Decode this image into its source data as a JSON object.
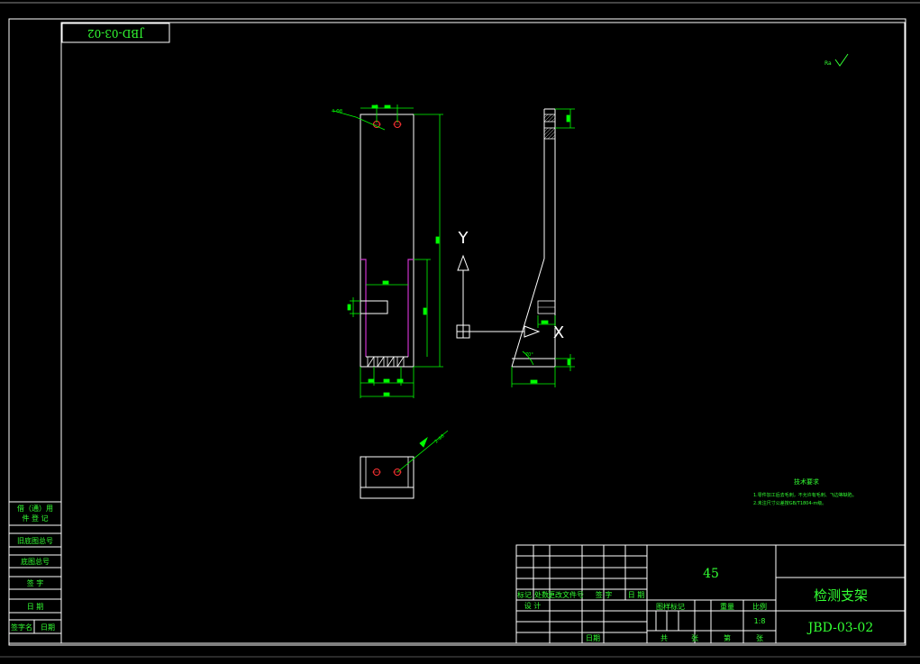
{
  "drawing": {
    "code_top": "JBD-03-02",
    "material": "45",
    "title": "检测支架",
    "code": "JBD-03-02",
    "scale": "1:8"
  },
  "annotations": {
    "axis_y": "Y",
    "axis_x": "X",
    "tech_title": "技术要求",
    "tech_line_1": "1.零件加工后去毛刺，不允许有毛刺、飞边等缺陷。",
    "tech_line_2": "2.未注尺寸公差按GB/T1804-m级。"
  },
  "left_labels": [
    "借（通）用",
    "件 登 记",
    "旧底图总号",
    "底图总号",
    "签  字",
    "日  期",
    "签字名",
    "日期"
  ],
  "title_block": {
    "header": [
      "标记",
      "处数",
      "更改文件号",
      "签  字",
      "日  期"
    ],
    "row_design": "设  计",
    "row_date": "日期",
    "stage_header": [
      "图样标记",
      "重量",
      "比例"
    ],
    "sheet": [
      "共",
      "张",
      "第",
      "张"
    ]
  },
  "colors": {
    "background": "#000000",
    "line": "#ffffff",
    "dimension": "#00ff00",
    "text": "#33ff33",
    "hidden": "#cc33cc",
    "hole": "#ff3333"
  }
}
